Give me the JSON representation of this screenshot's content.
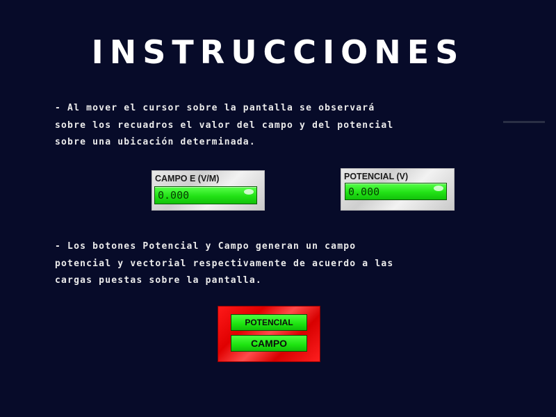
{
  "title": "INSTRUCCIONES",
  "paragraph1": [
    "- Al mover el cursor sobre la pantalla se observará",
    "sobre los recuadros el valor del campo y del potencial",
    "sobre una ubicación determinada."
  ],
  "paragraph2": [
    "- Los botones Potencial y Campo generan un campo",
    "potencial y vectorial respectivamente de acuerdo a las",
    "cargas puestas sobre la pantalla."
  ],
  "readouts": {
    "campo": {
      "label": "CAMPO E (V/M)",
      "value": "0.000"
    },
    "potencial": {
      "label": "POTENCIAL (V)",
      "value": "0.000"
    }
  },
  "buttons": {
    "potencial": "POTENCIAL",
    "campo": "CAMPO"
  },
  "colors": {
    "background": "#070b29",
    "readout_green": "#22e216",
    "button_panel_red": "#e00000"
  }
}
